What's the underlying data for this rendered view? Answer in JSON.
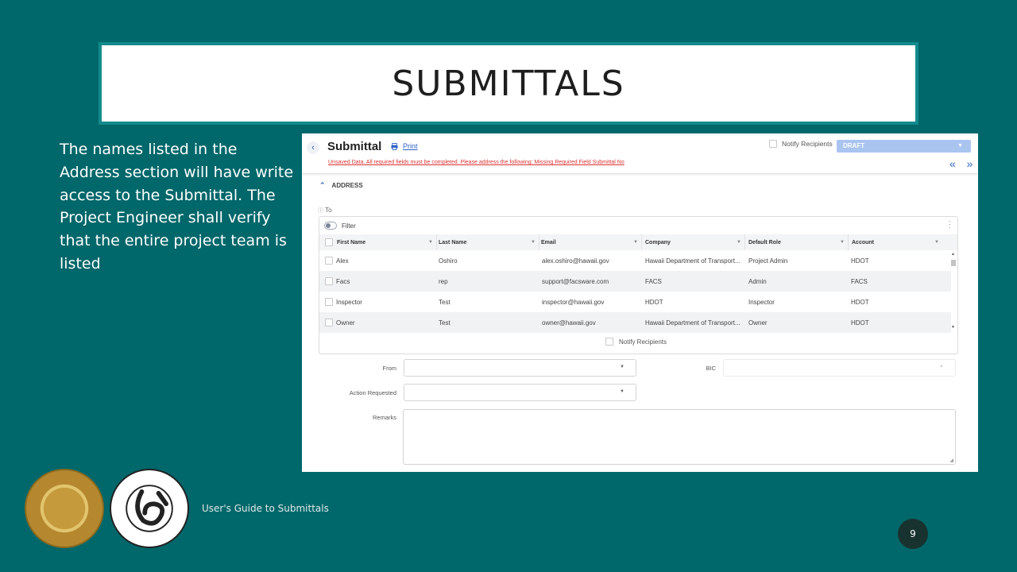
{
  "slide": {
    "title": "SUBMITTALS",
    "body": "The names listed in the Address section will have write access to the Submittal. The Project Engineer shall verify that the entire project team is listed",
    "footer": "User's Guide to Submittals",
    "page_number": "9"
  },
  "app": {
    "title": "Submittal",
    "print_label": "Print",
    "warning": "Unsaved Data. All required fields must be completed. Please address the following: Missing Required Field Submittal No",
    "notify_label": "Notify Recipients",
    "status": "DRAFT",
    "nav_arrows": "« »",
    "address_section": "ADDRESS",
    "to_label": "To",
    "filter_label": "Filter",
    "columns": [
      "First Name",
      "Last Name",
      "Email",
      "Company",
      "Default Role",
      "Account"
    ],
    "rows": [
      [
        "Alex",
        "Oshiro",
        "alex.oshiro@hawaii.gov",
        "Hawaii Department of Transport...",
        "Project Admin",
        "HDOT"
      ],
      [
        "Facs",
        "rep",
        "support@facsware.com",
        "FACS",
        "Admin",
        "FACS"
      ],
      [
        "Inspector",
        "Test",
        "inspector@hawaii.gov",
        "HDOT",
        "Inspector",
        "HDOT"
      ],
      [
        "Owner",
        "Test",
        "owner@hawaii.gov",
        "Hawaii Department of Transport...",
        "Owner",
        "HDOT"
      ]
    ],
    "grid_notify_label": "Notify Recipients",
    "from_label": "From",
    "bic_label": "BIC",
    "action_requested_label": "Action Requested",
    "remarks_label": "Remarks"
  },
  "colors": {
    "background": "#00676a",
    "title_border": "#138a8c",
    "accent_blue": "#2e63c7",
    "status_bg": "#aac4f0",
    "warning": "#dd3333"
  }
}
